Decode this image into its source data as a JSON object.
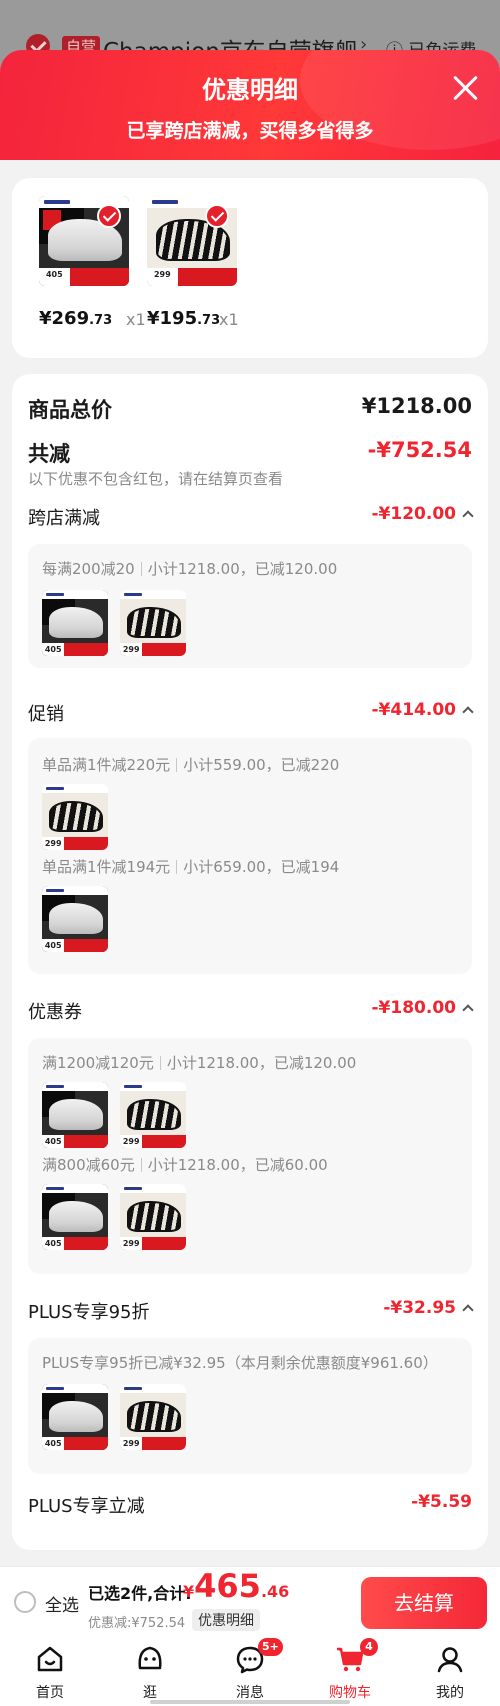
{
  "background_store": {
    "tag": "自营",
    "name": "Champion京东自营旗舰",
    "free_shipping": "ⓘ 已免运费"
  },
  "panel": {
    "title": "优惠明细",
    "subtitle": "已享跨店满减，买得多省得多"
  },
  "products": [
    {
      "price_currency": "¥",
      "price_int": "269",
      "price_dec": ".73",
      "qty": "x1",
      "thumb_price": "405"
    },
    {
      "price_currency": "¥",
      "price_int": "195",
      "price_dec": ".73",
      "qty": "x1",
      "thumb_price": "299"
    }
  ],
  "summary": {
    "total_label": "商品总价",
    "total_value": "¥1218.00",
    "reduce_label": "共减",
    "reduce_value": "-¥752.54",
    "reduce_note": "以下优惠不包含红包，请在结算页查看"
  },
  "sections": {
    "cross_store": {
      "label": "跨店满减",
      "value": "-¥120.00",
      "rule": "每满200减20",
      "detail": "小计1218.00，已减120.00"
    },
    "promotion": {
      "label": "促销",
      "value": "-¥414.00",
      "rule1": "单品满1件减220元",
      "detail1": "小计559.00，已减220",
      "rule2": "单品满1件减194元",
      "detail2": "小计659.00，已减194"
    },
    "coupon": {
      "label": "优惠券",
      "value": "-¥180.00",
      "rule1": "满1200减120元",
      "detail1": "小计1218.00，已减120.00",
      "rule2": "满800减60元",
      "detail2": "小计1218.00，已减60.00"
    },
    "plus95": {
      "label": "PLUS专享95折",
      "value": "-¥32.95",
      "rule": "PLUS专享95折已减¥32.95（本月剩余优惠额度¥961.60）"
    },
    "plus_instant": {
      "label": "PLUS专享立减",
      "value": "-¥5.59"
    }
  },
  "checkout": {
    "select_all": "全选",
    "selected": "已选2件,合计:",
    "total_currency": "¥",
    "total_int": "465",
    "total_dec": ".46",
    "discount_text": "优惠减:¥752.54",
    "detail_chip": "优惠明细",
    "button": "去结算"
  },
  "tabbar": {
    "items": [
      {
        "label": "首页",
        "icon": "home-icon"
      },
      {
        "label": "逛",
        "icon": "face-icon"
      },
      {
        "label": "消息",
        "icon": "message-icon",
        "badge": "5+"
      },
      {
        "label": "购物车",
        "icon": "cart-icon",
        "badge": "4"
      },
      {
        "label": "我的",
        "icon": "profile-icon"
      }
    ],
    "active": "购物车"
  },
  "colors": {
    "accent_red": "#f0252f",
    "header_red": "#f3243c"
  }
}
